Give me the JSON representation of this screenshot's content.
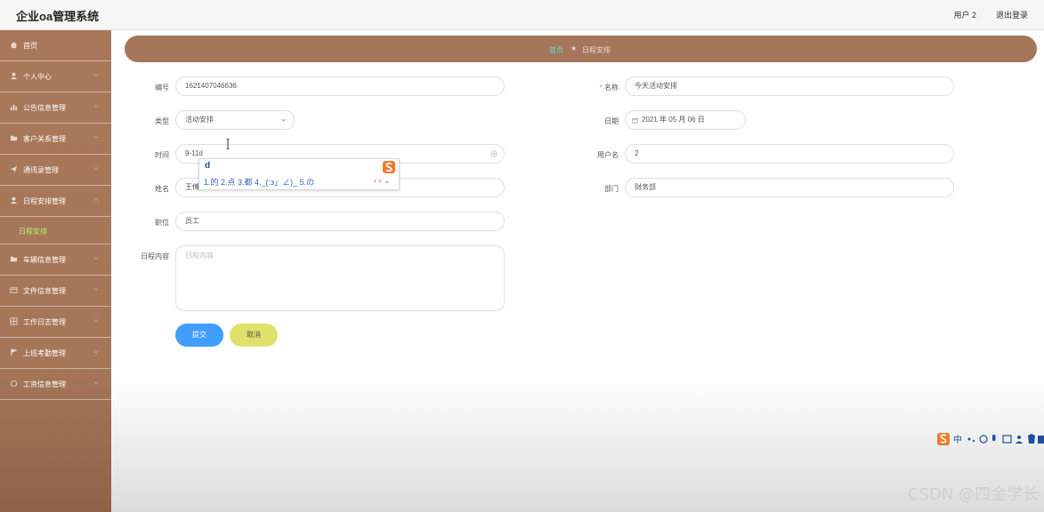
{
  "app": {
    "title": "企业oa管理系统"
  },
  "header": {
    "user_label": "用户 2",
    "logout_label": "退出登录"
  },
  "sidebar": {
    "items": [
      {
        "label": "首页",
        "icon": "home-icon",
        "has_chevron": false
      },
      {
        "label": "个人中心",
        "icon": "user-icon",
        "has_chevron": true
      },
      {
        "label": "公告信息管理",
        "icon": "chart-icon",
        "has_chevron": true
      },
      {
        "label": "客户关系管理",
        "icon": "folder-icon",
        "has_chevron": true
      },
      {
        "label": "通讯录管理",
        "icon": "send-icon",
        "has_chevron": true
      },
      {
        "label": "日程安排管理",
        "icon": "user-icon",
        "has_chevron": true,
        "expanded": true,
        "children": [
          {
            "label": "日程安排",
            "active": true
          }
        ]
      },
      {
        "label": "车辆信息管理",
        "icon": "folder-icon",
        "has_chevron": true
      },
      {
        "label": "文件信息管理",
        "icon": "file-icon",
        "has_chevron": true
      },
      {
        "label": "工作日志管理",
        "icon": "grid-icon",
        "has_chevron": true
      },
      {
        "label": "上班考勤管理",
        "icon": "flag-icon",
        "has_chevron": true
      },
      {
        "label": "工资信息管理",
        "icon": "circle-icon",
        "has_chevron": true
      }
    ]
  },
  "breadcrumb": {
    "home": "首页",
    "current": "日程安排"
  },
  "form": {
    "bianhao": {
      "label": "编号",
      "value": "1621407046636"
    },
    "mingcheng": {
      "label": "名称",
      "value": "今天活动安排"
    },
    "leixing": {
      "label": "类型",
      "value": "活动安排"
    },
    "riqi": {
      "label": "日期",
      "value": "2021 年 05 月 06 日"
    },
    "shijian": {
      "label": "时间",
      "value": "9-11d"
    },
    "yonghuming": {
      "label": "用户名",
      "value": "2"
    },
    "xingming": {
      "label": "姓名",
      "value": "王傅"
    },
    "bumen": {
      "label": "部门",
      "value": "财务部"
    },
    "zhiwei": {
      "label": "职位",
      "value": "员工"
    },
    "neirong": {
      "label": "日程内容",
      "placeholder": "日程内容"
    },
    "submit_label": "提交",
    "cancel_label": "取消"
  },
  "ime": {
    "composition": "d",
    "candidates": "1.的  2.点  3.都  4._(:з」∠)_  5.の",
    "nav": "‹ › ⌄"
  },
  "watermark": "CSDN @四金学长",
  "colors": {
    "sidebar": "#a9785a",
    "breadcrumb": "#a5765a",
    "submit": "#409eff",
    "cancel": "#dfe26a",
    "active_sub": "#b9f27c",
    "accent_link": "#5fe0d8"
  }
}
